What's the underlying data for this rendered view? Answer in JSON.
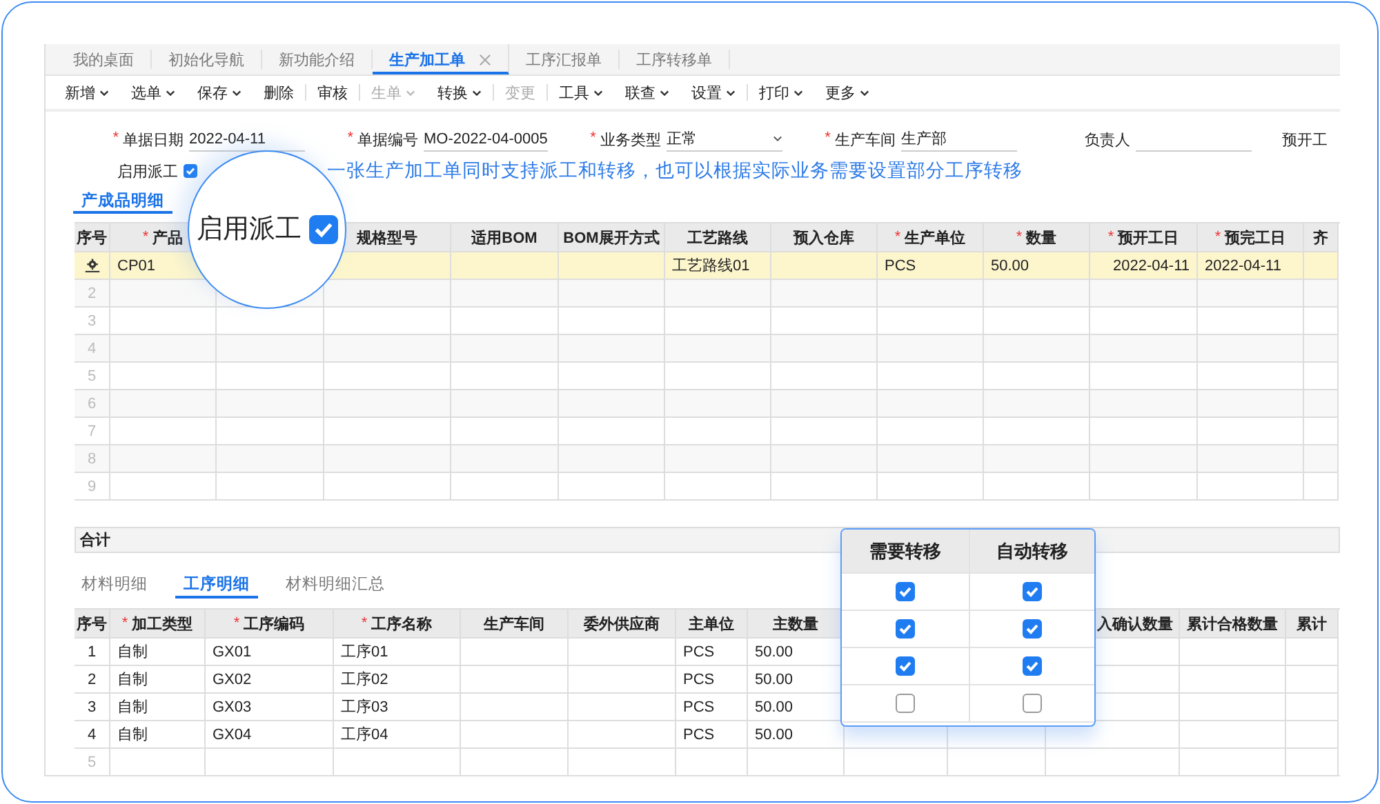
{
  "tabs": [
    {
      "label": "我的桌面",
      "selected": false,
      "closable": false
    },
    {
      "label": "初始化导航",
      "selected": false,
      "closable": false
    },
    {
      "label": "新功能介绍",
      "selected": false,
      "closable": false
    },
    {
      "label": "生产加工单",
      "selected": true,
      "closable": true
    },
    {
      "label": "工序汇报单",
      "selected": false,
      "closable": false
    },
    {
      "label": "工序转移单",
      "selected": false,
      "closable": false
    }
  ],
  "toolbar": [
    {
      "kind": "item",
      "label": "新增",
      "caret": true,
      "disabled": false
    },
    {
      "kind": "item",
      "label": "选单",
      "caret": true,
      "disabled": false
    },
    {
      "kind": "item",
      "label": "保存",
      "caret": true,
      "disabled": false
    },
    {
      "kind": "item",
      "label": "删除",
      "caret": false,
      "disabled": false
    },
    {
      "kind": "separator"
    },
    {
      "kind": "item",
      "label": "审核",
      "caret": false,
      "disabled": false
    },
    {
      "kind": "separator"
    },
    {
      "kind": "item",
      "label": "生单",
      "caret": true,
      "disabled": true
    },
    {
      "kind": "item",
      "label": "转换",
      "caret": true,
      "disabled": false
    },
    {
      "kind": "separator"
    },
    {
      "kind": "item",
      "label": "变更",
      "caret": false,
      "disabled": true
    },
    {
      "kind": "separator"
    },
    {
      "kind": "item",
      "label": "工具",
      "caret": true,
      "disabled": false
    },
    {
      "kind": "item",
      "label": "联查",
      "caret": true,
      "disabled": false
    },
    {
      "kind": "item",
      "label": "设置",
      "caret": true,
      "disabled": false
    },
    {
      "kind": "separator"
    },
    {
      "kind": "item",
      "label": "打印",
      "caret": true,
      "disabled": false
    },
    {
      "kind": "item",
      "label": "更多",
      "caret": true,
      "disabled": false
    }
  ],
  "form": {
    "fields": [
      {
        "kind": "text",
        "mark": "*",
        "label": "单据日期",
        "value": "2022-04-11"
      },
      {
        "kind": "text",
        "mark": "*",
        "label": "单据编号",
        "value": "MO-2022-04-0005"
      },
      {
        "kind": "select",
        "mark": "*",
        "label": "业务类型",
        "value": "正常"
      },
      {
        "kind": "text",
        "mark": "*",
        "label": "生产车间",
        "value": "生产部"
      },
      {
        "kind": "text",
        "label": "负责人"
      },
      {
        "kind": "cut",
        "label": "预开工"
      }
    ],
    "dispatch": {
      "label": "启用派工",
      "checked": true
    },
    "notice": "一张生产加工单同时支持派工和转移，也可以根据实际业务需要设置部分工序转移"
  },
  "product_tabs": [
    {
      "label": "产成品明细",
      "selected": true
    }
  ],
  "product_table": {
    "columns": [
      {
        "label": "序号"
      },
      {
        "mark": "*",
        "label": "产品"
      },
      {},
      {
        "label": "规格型号"
      },
      {
        "label": "适用BOM"
      },
      {
        "label": "BOM展开方式"
      },
      {
        "label": "工艺路线"
      },
      {
        "label": "预入仓库"
      },
      {
        "mark": "*",
        "label": "生产单位"
      },
      {
        "mark": "*",
        "label": "数量"
      },
      {
        "mark": "*",
        "label": "预开工日"
      },
      {
        "mark": "*",
        "label": "预完工日"
      },
      {
        "label": "齐"
      }
    ],
    "rows": [
      {
        "current": true,
        "cells": [
          "CP01",
          null,
          null,
          null,
          null,
          "工艺路线01",
          null,
          "PCS",
          "50.00",
          "2022-04-11",
          "2022-04-11",
          null
        ]
      },
      {
        "current": false,
        "number": "2"
      },
      {
        "current": false,
        "number": "3"
      },
      {
        "current": false,
        "number": "4"
      },
      {
        "current": false,
        "number": "5"
      },
      {
        "current": false,
        "number": "6"
      },
      {
        "current": false,
        "number": "7"
      },
      {
        "current": false,
        "number": "8"
      },
      {
        "current": false,
        "number": "9"
      }
    ]
  },
  "total_label": "合计",
  "detail_tabs": [
    {
      "label": "材料明细",
      "selected": false
    },
    {
      "label": "工序明细",
      "selected": true
    },
    {
      "label": "材料明细汇总",
      "selected": false
    }
  ],
  "process_table": {
    "columns": [
      {
        "label": "序号"
      },
      {
        "mark": "*",
        "label": "加工类型"
      },
      {
        "mark": "*",
        "label": "工序编码"
      },
      {
        "mark": "*",
        "label": "工序名称"
      },
      {
        "label": "生产车间"
      },
      {
        "label": "委外供应商"
      },
      {
        "label": "主单位"
      },
      {
        "label": "主数量"
      },
      {},
      {},
      {
        "label": "入确认数量"
      },
      {
        "label": "累计合格数量"
      },
      {
        "label": "累计"
      }
    ],
    "rows": [
      {
        "number": "1",
        "cells": [
          "自制",
          "GX01",
          "工序01",
          null,
          null,
          "PCS",
          "50.00",
          null,
          null,
          null,
          null,
          null
        ]
      },
      {
        "number": "2",
        "cells": [
          "自制",
          "GX02",
          "工序02",
          null,
          null,
          "PCS",
          "50.00",
          null,
          null,
          null,
          null,
          null
        ]
      },
      {
        "number": "3",
        "cells": [
          "自制",
          "GX03",
          "工序03",
          null,
          null,
          "PCS",
          "50.00",
          null,
          null,
          null,
          null,
          null
        ]
      },
      {
        "number": "4",
        "cells": [
          "自制",
          "GX04",
          "工序04",
          null,
          null,
          "PCS",
          "50.00",
          null,
          null,
          null,
          null,
          null
        ]
      },
      {
        "number": "5"
      }
    ]
  },
  "magnifier": {
    "label": "启用派工",
    "checked": true
  },
  "transfer_popup": {
    "columns": [
      "需要转移",
      "自动转移"
    ],
    "rows": [
      {
        "need_transfer": true,
        "auto_transfer": true
      },
      {
        "need_transfer": true,
        "auto_transfer": true
      },
      {
        "need_transfer": true,
        "auto_transfer": true
      },
      {
        "need_transfer": false,
        "auto_transfer": false
      }
    ]
  }
}
